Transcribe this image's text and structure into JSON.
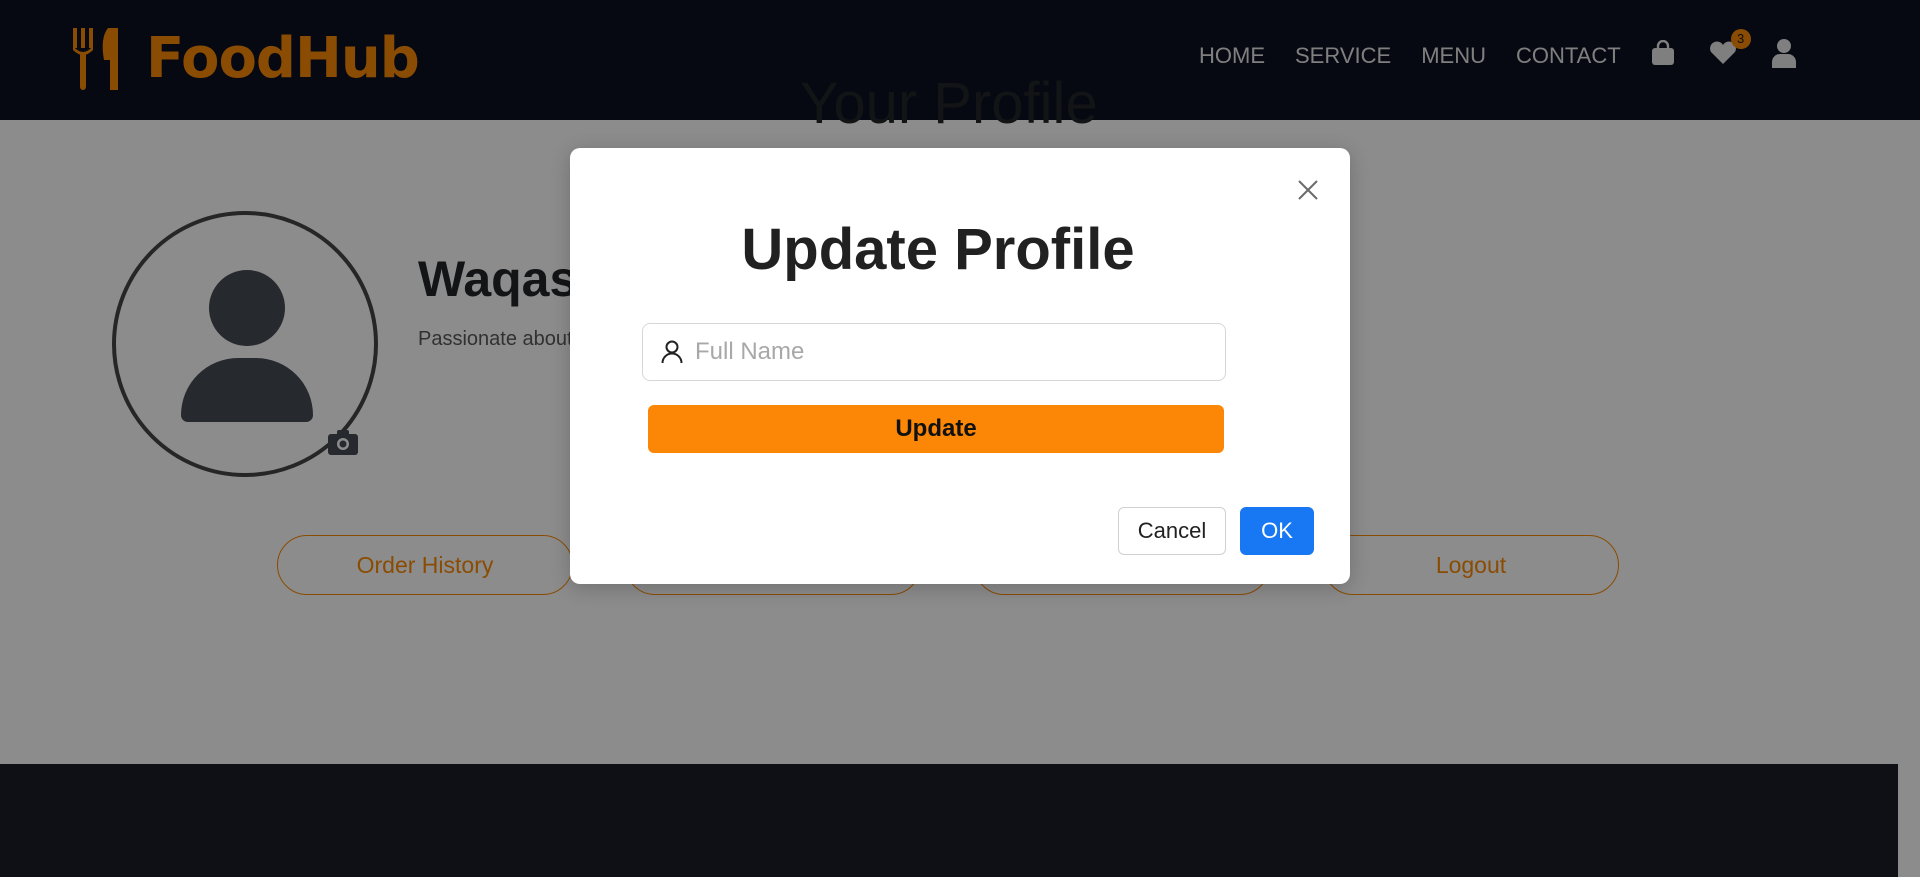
{
  "navbar": {
    "brand": "FoodHub",
    "links": [
      "HOME",
      "SERVICE",
      "MENU",
      "CONTACT"
    ],
    "wishlist_count": "3"
  },
  "profile": {
    "heading": "Your Profile",
    "name": "Waqas",
    "bio": "Passionate about",
    "actions": [
      "Order History",
      "",
      "",
      "Logout"
    ]
  },
  "modal": {
    "title": "Update Profile",
    "input_placeholder": "Full Name",
    "update_label": "Update",
    "cancel_label": "Cancel",
    "ok_label": "OK"
  },
  "colors": {
    "brand_orange": "#fc8a06",
    "navbar_bg": "#0b1121",
    "ok_blue": "#1877f2"
  }
}
